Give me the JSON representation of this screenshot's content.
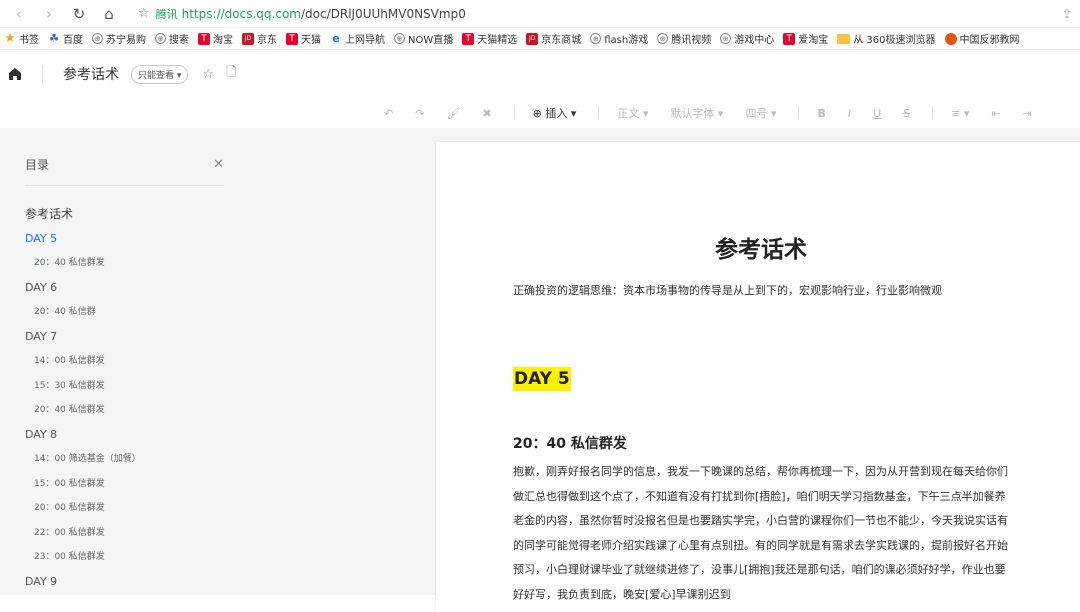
{
  "browser": {
    "url_host_label": "腾讯",
    "url_prefix": "https://docs.qq.com",
    "url_path": "/doc/DRlJ0UUhMV0NSVmp0"
  },
  "bookmarks": [
    {
      "label": "书签",
      "icon": "star-icon"
    },
    {
      "label": "百度",
      "icon": "paw-icon"
    },
    {
      "label": "苏宁易购",
      "icon": "globe-icon"
    },
    {
      "label": "搜索",
      "icon": "globe-icon"
    },
    {
      "label": "淘宝",
      "icon": "tmall-icon"
    },
    {
      "label": "京东",
      "icon": "jd-icon"
    },
    {
      "label": "天猫",
      "icon": "tmall-icon"
    },
    {
      "label": "上网导航",
      "icon": "ie-icon"
    },
    {
      "label": "NOW直播",
      "icon": "globe-icon"
    },
    {
      "label": "天猫精选",
      "icon": "tmall-icon"
    },
    {
      "label": "京东商城",
      "icon": "jd-icon"
    },
    {
      "label": "flash游戏",
      "icon": "globe-icon"
    },
    {
      "label": "腾讯视频",
      "icon": "globe-icon"
    },
    {
      "label": "游戏中心",
      "icon": "globe-icon"
    },
    {
      "label": "爱淘宝",
      "icon": "tmall-icon"
    },
    {
      "label": "从 360极速浏览器",
      "icon": "folder-icon"
    },
    {
      "label": "中国反邪教网",
      "icon": "fire-icon"
    }
  ],
  "header": {
    "doc_title": "参考话术",
    "readonly_label": "只能查看"
  },
  "toolbar": {
    "insert_label": "插入",
    "text_style_label": "正文",
    "font_label": "默认字体",
    "size_label": "四号",
    "bold_label": "B",
    "italic_label": "I",
    "underline_label": "U",
    "strike_label": "S"
  },
  "toc": {
    "title": "目录",
    "items": [
      {
        "label": "参考话术",
        "level": 1,
        "active": false
      },
      {
        "label": "DAY 5",
        "level": 2,
        "active": true
      },
      {
        "label": "20：40 私信群发",
        "level": 3,
        "active": false
      },
      {
        "label": "DAY 6",
        "level": 2,
        "active": false
      },
      {
        "label": "20：40 私信群",
        "level": 3,
        "active": false
      },
      {
        "label": "DAY 7",
        "level": 2,
        "active": false
      },
      {
        "label": "14：00 私信群发",
        "level": 3,
        "active": false
      },
      {
        "label": "15：30 私信群发",
        "level": 3,
        "active": false
      },
      {
        "label": "20：40 私信群发",
        "level": 3,
        "active": false
      },
      {
        "label": "DAY 8",
        "level": 2,
        "active": false
      },
      {
        "label": "14：00 筛选基金（加餐）",
        "level": 3,
        "active": false
      },
      {
        "label": "15：00 私信群发",
        "level": 3,
        "active": false
      },
      {
        "label": "20：00 私信群发",
        "level": 3,
        "active": false
      },
      {
        "label": "22：00 私信群发",
        "level": 3,
        "active": false
      },
      {
        "label": "23：00 私信群发",
        "level": 3,
        "active": false
      },
      {
        "label": "DAY 9",
        "level": 2,
        "active": false
      }
    ]
  },
  "document": {
    "title": "参考话术",
    "intro": "正确投资的逻辑思维：资本市场事物的传导是从上到下的，宏观影响行业，行业影响微观",
    "day_heading": "DAY 5",
    "sub_heading": "20：40 私信群发",
    "body": "抱歉，刚弄好报名同学的信息，我发一下晚课的总结，帮你再梳理一下，因为从开营到现在每天给你们做汇总也得做到这个点了，不知道有没有打扰到你[捂脸]，咱们明天学习指数基金，下午三点半加餐养老金的内容，虽然你暂时没报名但是也要踏实学完，小白营的课程你们一节也不能少，今天我说实话有的同学可能觉得老师介绍实践课了心里有点别扭。有的同学就是有需求去学实践课的，提前报好名开始预习，小白理财课毕业了就继续进修了，没事儿[拥抱]我还是那句话，咱们的课必须好好学，作业也要好好写，我负责到底，晚安[爱心]早课别迟到"
  },
  "colors": {
    "accent": "#1e6fff",
    "highlight": "#fff200",
    "url_green": "#1aa260"
  }
}
